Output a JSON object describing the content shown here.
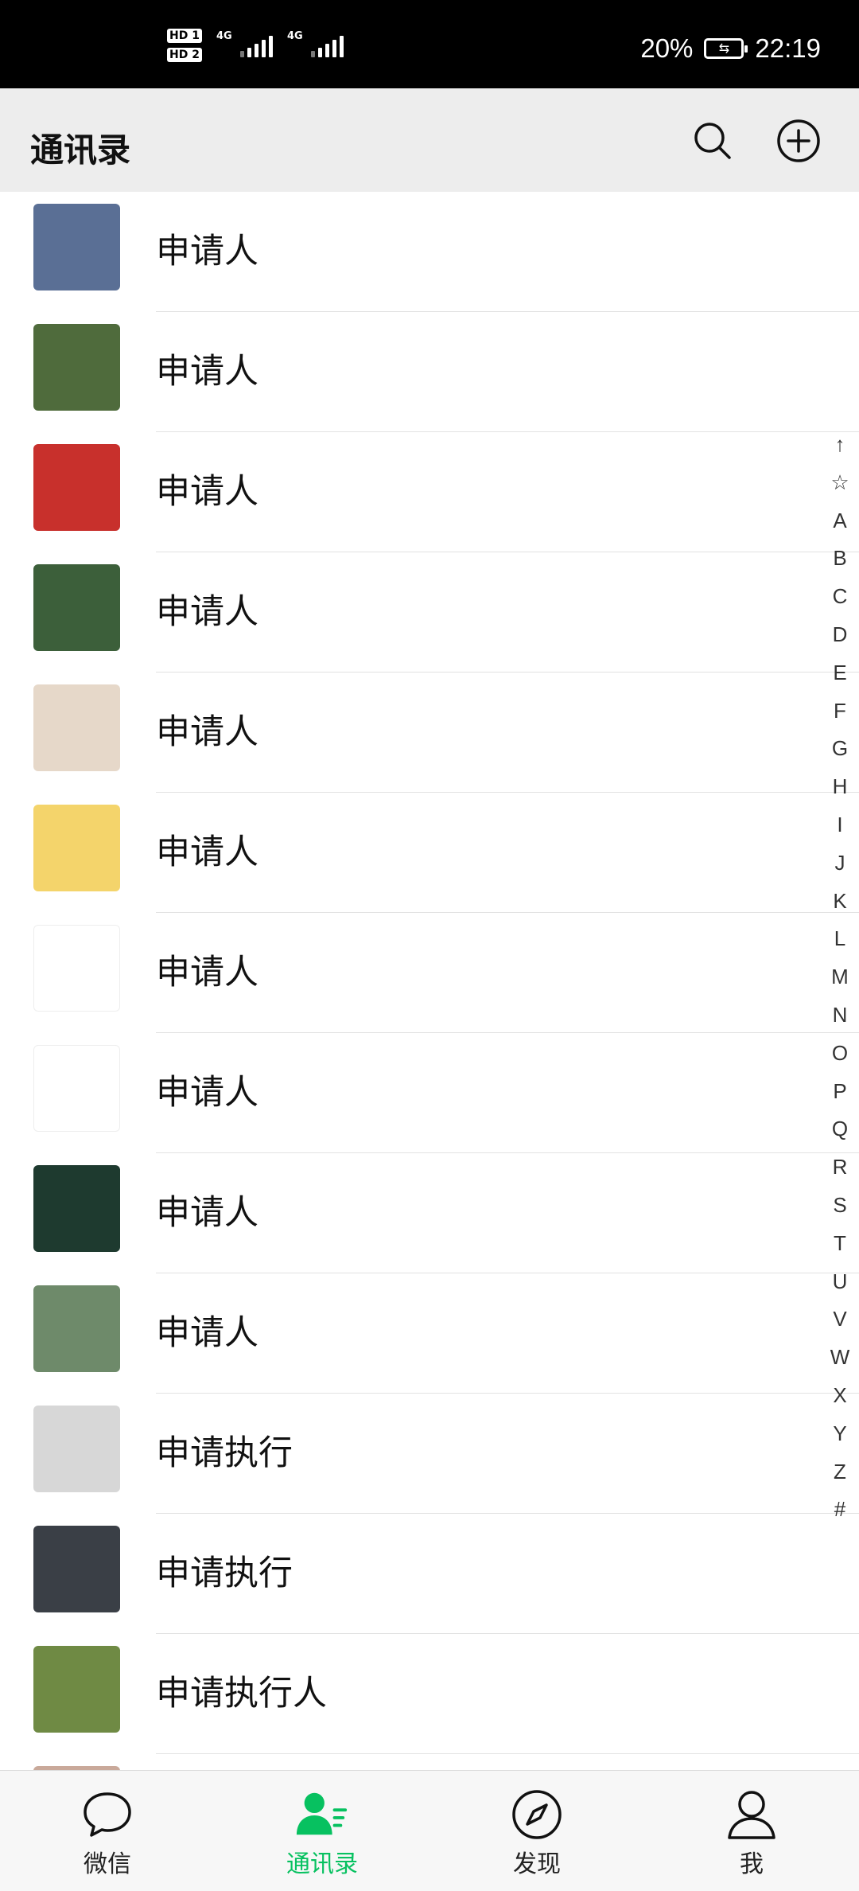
{
  "status_bar": {
    "hd1": "HD 1",
    "hd2": "HD 2",
    "net1": "4G",
    "net2": "4G",
    "battery": "20%",
    "time": "22:19"
  },
  "header": {
    "title": "通讯录",
    "search_icon": "search-icon",
    "add_icon": "plus-circle-icon"
  },
  "contacts": [
    {
      "name": "申请人",
      "avatar": "#5a6f95"
    },
    {
      "name": "申请人",
      "avatar": "#4f6b3c"
    },
    {
      "name": "申请人",
      "avatar": "#c8302c"
    },
    {
      "name": "申请人",
      "avatar": "#3c5f3a"
    },
    {
      "name": "申请人",
      "avatar": "#e6d8c9"
    },
    {
      "name": "申请人",
      "avatar": "#f4d46b"
    },
    {
      "name": "申请人",
      "avatar": "#ffffff"
    },
    {
      "name": "申请人",
      "avatar": "#ffffff"
    },
    {
      "name": "申请人",
      "avatar": "#1e3a2f"
    },
    {
      "name": "申请人",
      "avatar": "#6e8a6a"
    },
    {
      "name": "申请执行",
      "avatar": "#d7d7d7"
    },
    {
      "name": "申请执行",
      "avatar": "#3a3f46"
    },
    {
      "name": "申请执行人",
      "avatar": "#6f8a44"
    }
  ],
  "index_letters": [
    "↑",
    "☆",
    "A",
    "B",
    "C",
    "D",
    "E",
    "F",
    "G",
    "H",
    "I",
    "J",
    "K",
    "L",
    "M",
    "N",
    "O",
    "P",
    "Q",
    "R",
    "S",
    "T",
    "U",
    "V",
    "W",
    "X",
    "Y",
    "Z",
    "#"
  ],
  "tabs": [
    {
      "label": "微信",
      "icon": "chat-bubble-icon",
      "active": false
    },
    {
      "label": "通讯录",
      "icon": "contacts-icon",
      "active": true
    },
    {
      "label": "发现",
      "icon": "compass-icon",
      "active": false
    },
    {
      "label": "我",
      "icon": "person-icon",
      "active": false
    }
  ],
  "colors": {
    "accent": "#07c160",
    "header_bg": "#ededed",
    "tabbar_bg": "#f7f7f7"
  }
}
